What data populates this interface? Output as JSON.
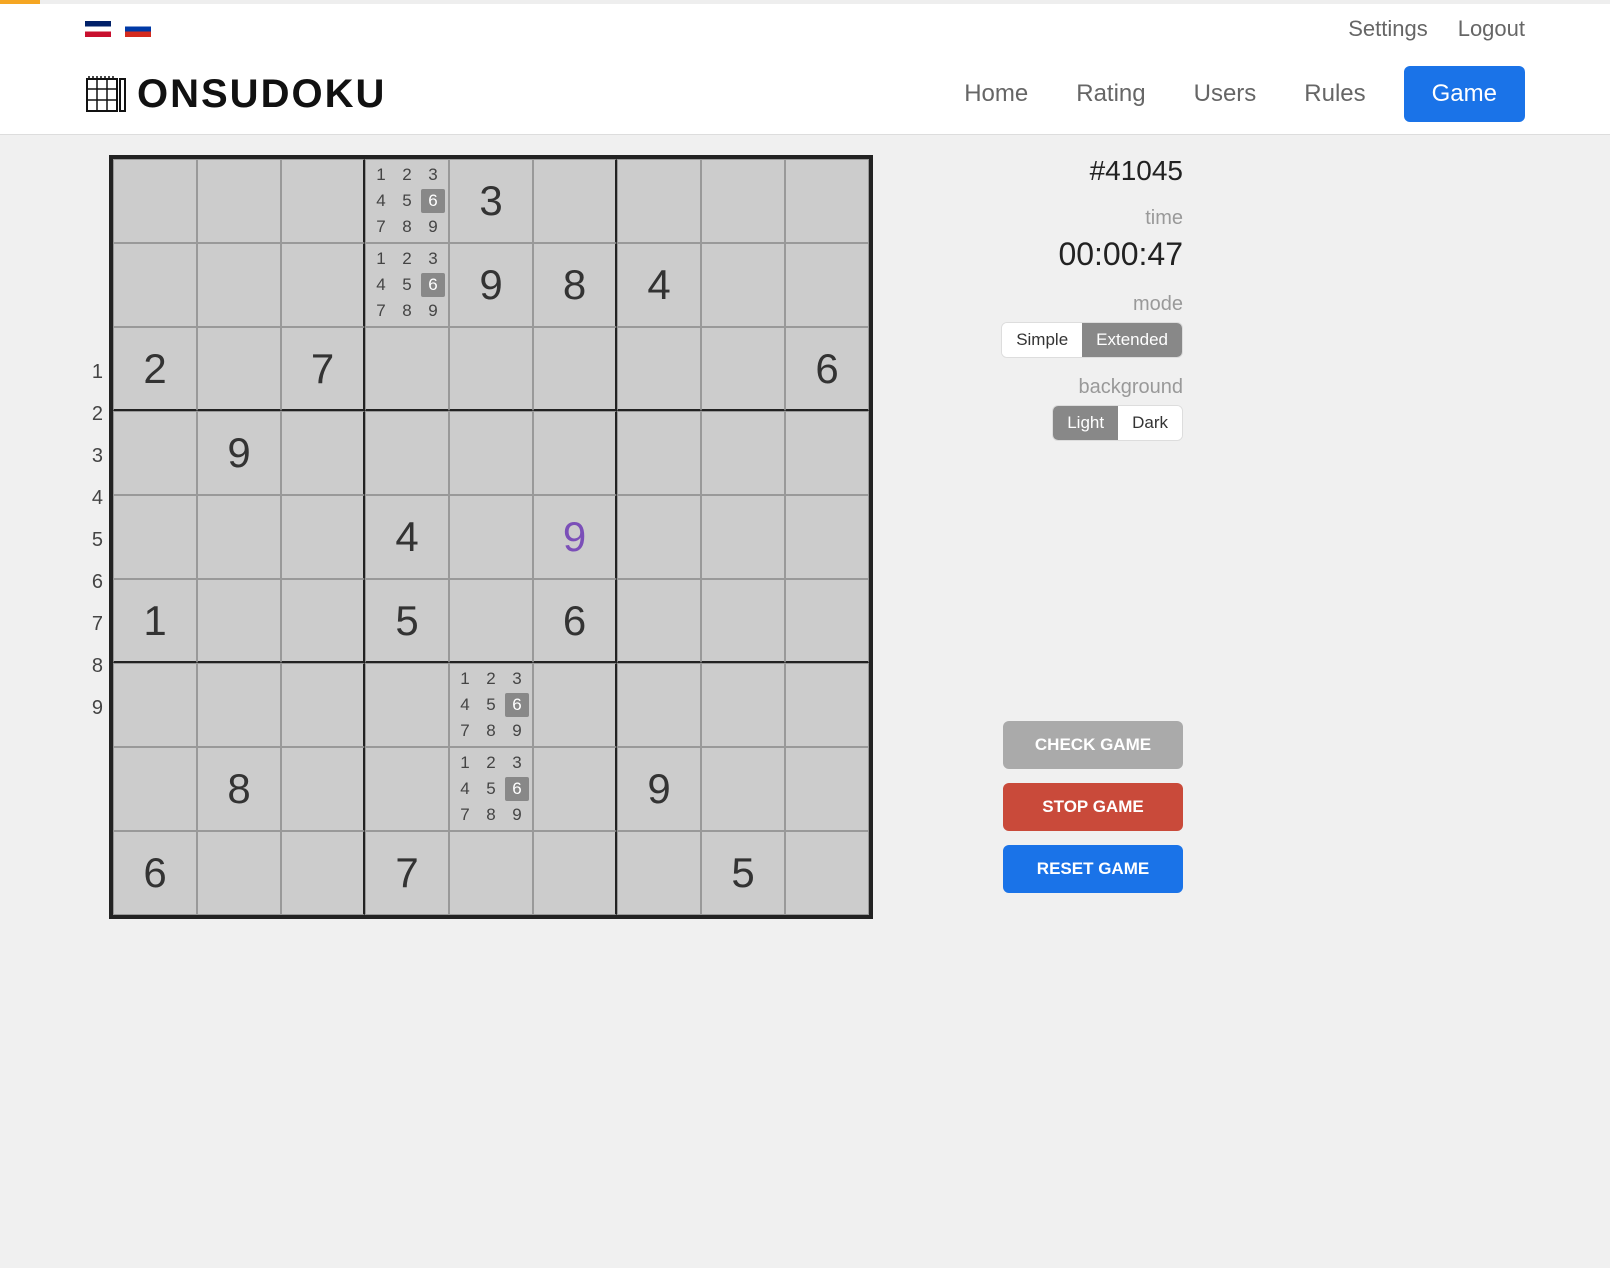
{
  "header": {
    "settings": "Settings",
    "logout": "Logout",
    "logo": "ONSUDOKU",
    "nav": {
      "home": "Home",
      "rating": "Rating",
      "users": "Users",
      "rules": "Rules",
      "game": "Game"
    }
  },
  "rowLabels": [
    "1",
    "2",
    "3",
    "4",
    "5",
    "6",
    "7",
    "8",
    "9"
  ],
  "side": {
    "gameId": "#41045",
    "timeLabel": "time",
    "timer": "00:00:47",
    "modeLabel": "mode",
    "modeSimple": "Simple",
    "modeExtended": "Extended",
    "bgLabel": "background",
    "bgLight": "Light",
    "bgDark": "Dark",
    "check": "CHECK GAME",
    "stop": "STOP GAME",
    "reset": "RESET GAME"
  },
  "board": {
    "cells": [
      {
        "r": 0,
        "c": 3,
        "type": "cands",
        "hilite": [
          6
        ]
      },
      {
        "r": 0,
        "c": 4,
        "type": "given",
        "v": "3"
      },
      {
        "r": 1,
        "c": 3,
        "type": "cands",
        "hilite": [
          6
        ]
      },
      {
        "r": 1,
        "c": 4,
        "type": "given",
        "v": "9"
      },
      {
        "r": 1,
        "c": 5,
        "type": "given",
        "v": "8"
      },
      {
        "r": 1,
        "c": 6,
        "type": "given",
        "v": "4"
      },
      {
        "r": 2,
        "c": 0,
        "type": "given",
        "v": "2"
      },
      {
        "r": 2,
        "c": 2,
        "type": "given",
        "v": "7"
      },
      {
        "r": 2,
        "c": 8,
        "type": "given",
        "v": "6"
      },
      {
        "r": 3,
        "c": 1,
        "type": "given",
        "v": "9"
      },
      {
        "r": 4,
        "c": 3,
        "type": "given",
        "v": "4"
      },
      {
        "r": 4,
        "c": 5,
        "type": "user",
        "v": "9"
      },
      {
        "r": 5,
        "c": 0,
        "type": "given",
        "v": "1"
      },
      {
        "r": 5,
        "c": 3,
        "type": "given",
        "v": "5"
      },
      {
        "r": 5,
        "c": 5,
        "type": "given",
        "v": "6"
      },
      {
        "r": 6,
        "c": 4,
        "type": "cands",
        "hilite": [
          6
        ]
      },
      {
        "r": 7,
        "c": 1,
        "type": "given",
        "v": "8"
      },
      {
        "r": 7,
        "c": 4,
        "type": "cands",
        "hilite": [
          6
        ]
      },
      {
        "r": 7,
        "c": 6,
        "type": "given",
        "v": "9"
      },
      {
        "r": 8,
        "c": 0,
        "type": "given",
        "v": "6"
      },
      {
        "r": 8,
        "c": 3,
        "type": "given",
        "v": "7"
      },
      {
        "r": 8,
        "c": 7,
        "type": "given",
        "v": "5"
      }
    ],
    "candDigits": [
      "1",
      "2",
      "3",
      "4",
      "5",
      "6",
      "7",
      "8",
      "9"
    ]
  }
}
